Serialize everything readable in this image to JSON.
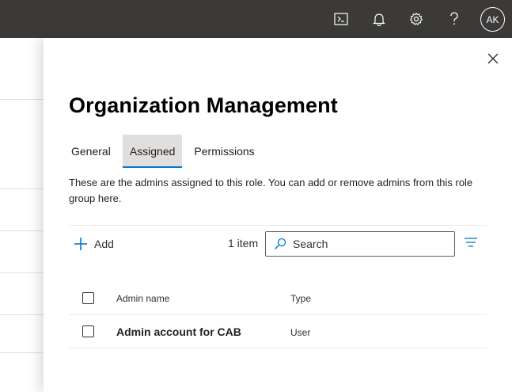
{
  "topbar": {
    "icons": [
      "terminal-icon",
      "bell-icon",
      "gear-icon",
      "help-icon"
    ],
    "avatar_initials": "AK",
    "bg_color": "#3b3a39"
  },
  "panel": {
    "title": "Organization Management",
    "tabs": [
      {
        "label": "General",
        "active": false
      },
      {
        "label": "Assigned",
        "active": true
      },
      {
        "label": "Permissions",
        "active": false
      }
    ],
    "description": "These are the admins assigned to this role. You can add or remove admins from this role group here.",
    "toolbar": {
      "add_label": "Add",
      "item_count": "1 item",
      "search_placeholder": "Search"
    },
    "list": {
      "columns": {
        "name": "Admin name",
        "type": "Type"
      },
      "rows": [
        {
          "name": "Admin account for CAB",
          "type": "User"
        }
      ]
    }
  },
  "colors": {
    "accent": "#0078d4",
    "active_tab_bg": "#e1dfdd"
  }
}
